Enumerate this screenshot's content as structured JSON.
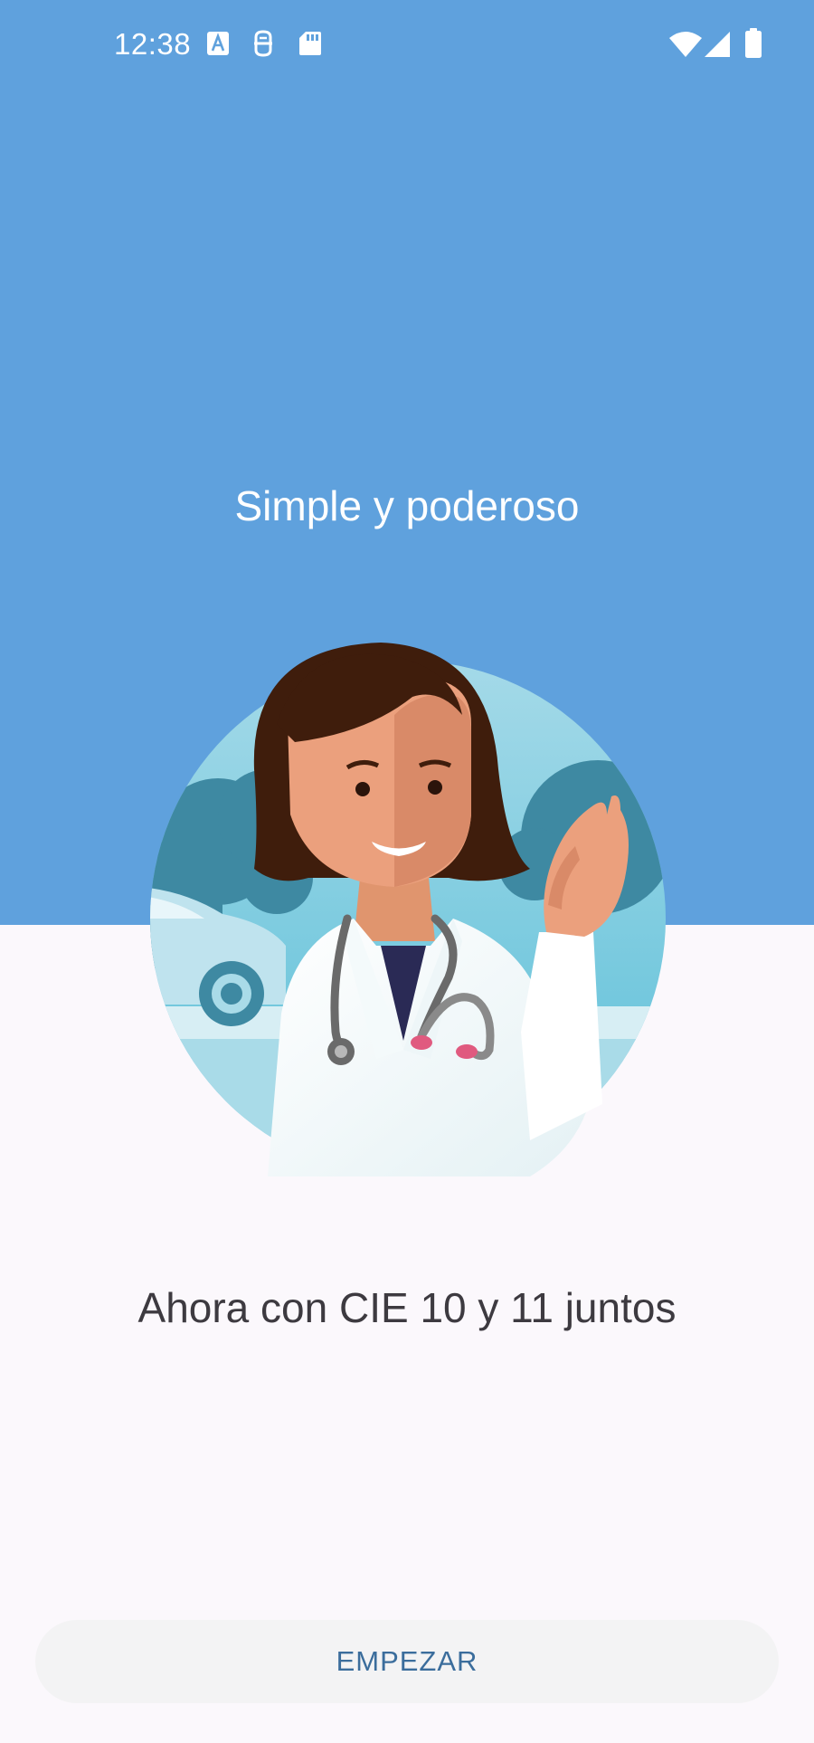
{
  "status_bar": {
    "time": "12:38",
    "left_icons": [
      "font-a-icon",
      "accessibility-icon",
      "sd-card-icon"
    ],
    "right_icons": [
      "wifi-icon",
      "signal-icon",
      "battery-icon"
    ]
  },
  "onboarding": {
    "headline": "Simple y poderoso",
    "illustration": "doctor-waving-illustration",
    "subtitle": "Ahora con CIE 10 y 11 juntos",
    "start_button_label": "EMPEZAR"
  },
  "colors": {
    "top_band": "#5fa1dd",
    "background": "#fbf8fc",
    "button_bg": "#f3f3f4",
    "button_text": "#3b6d9c"
  }
}
